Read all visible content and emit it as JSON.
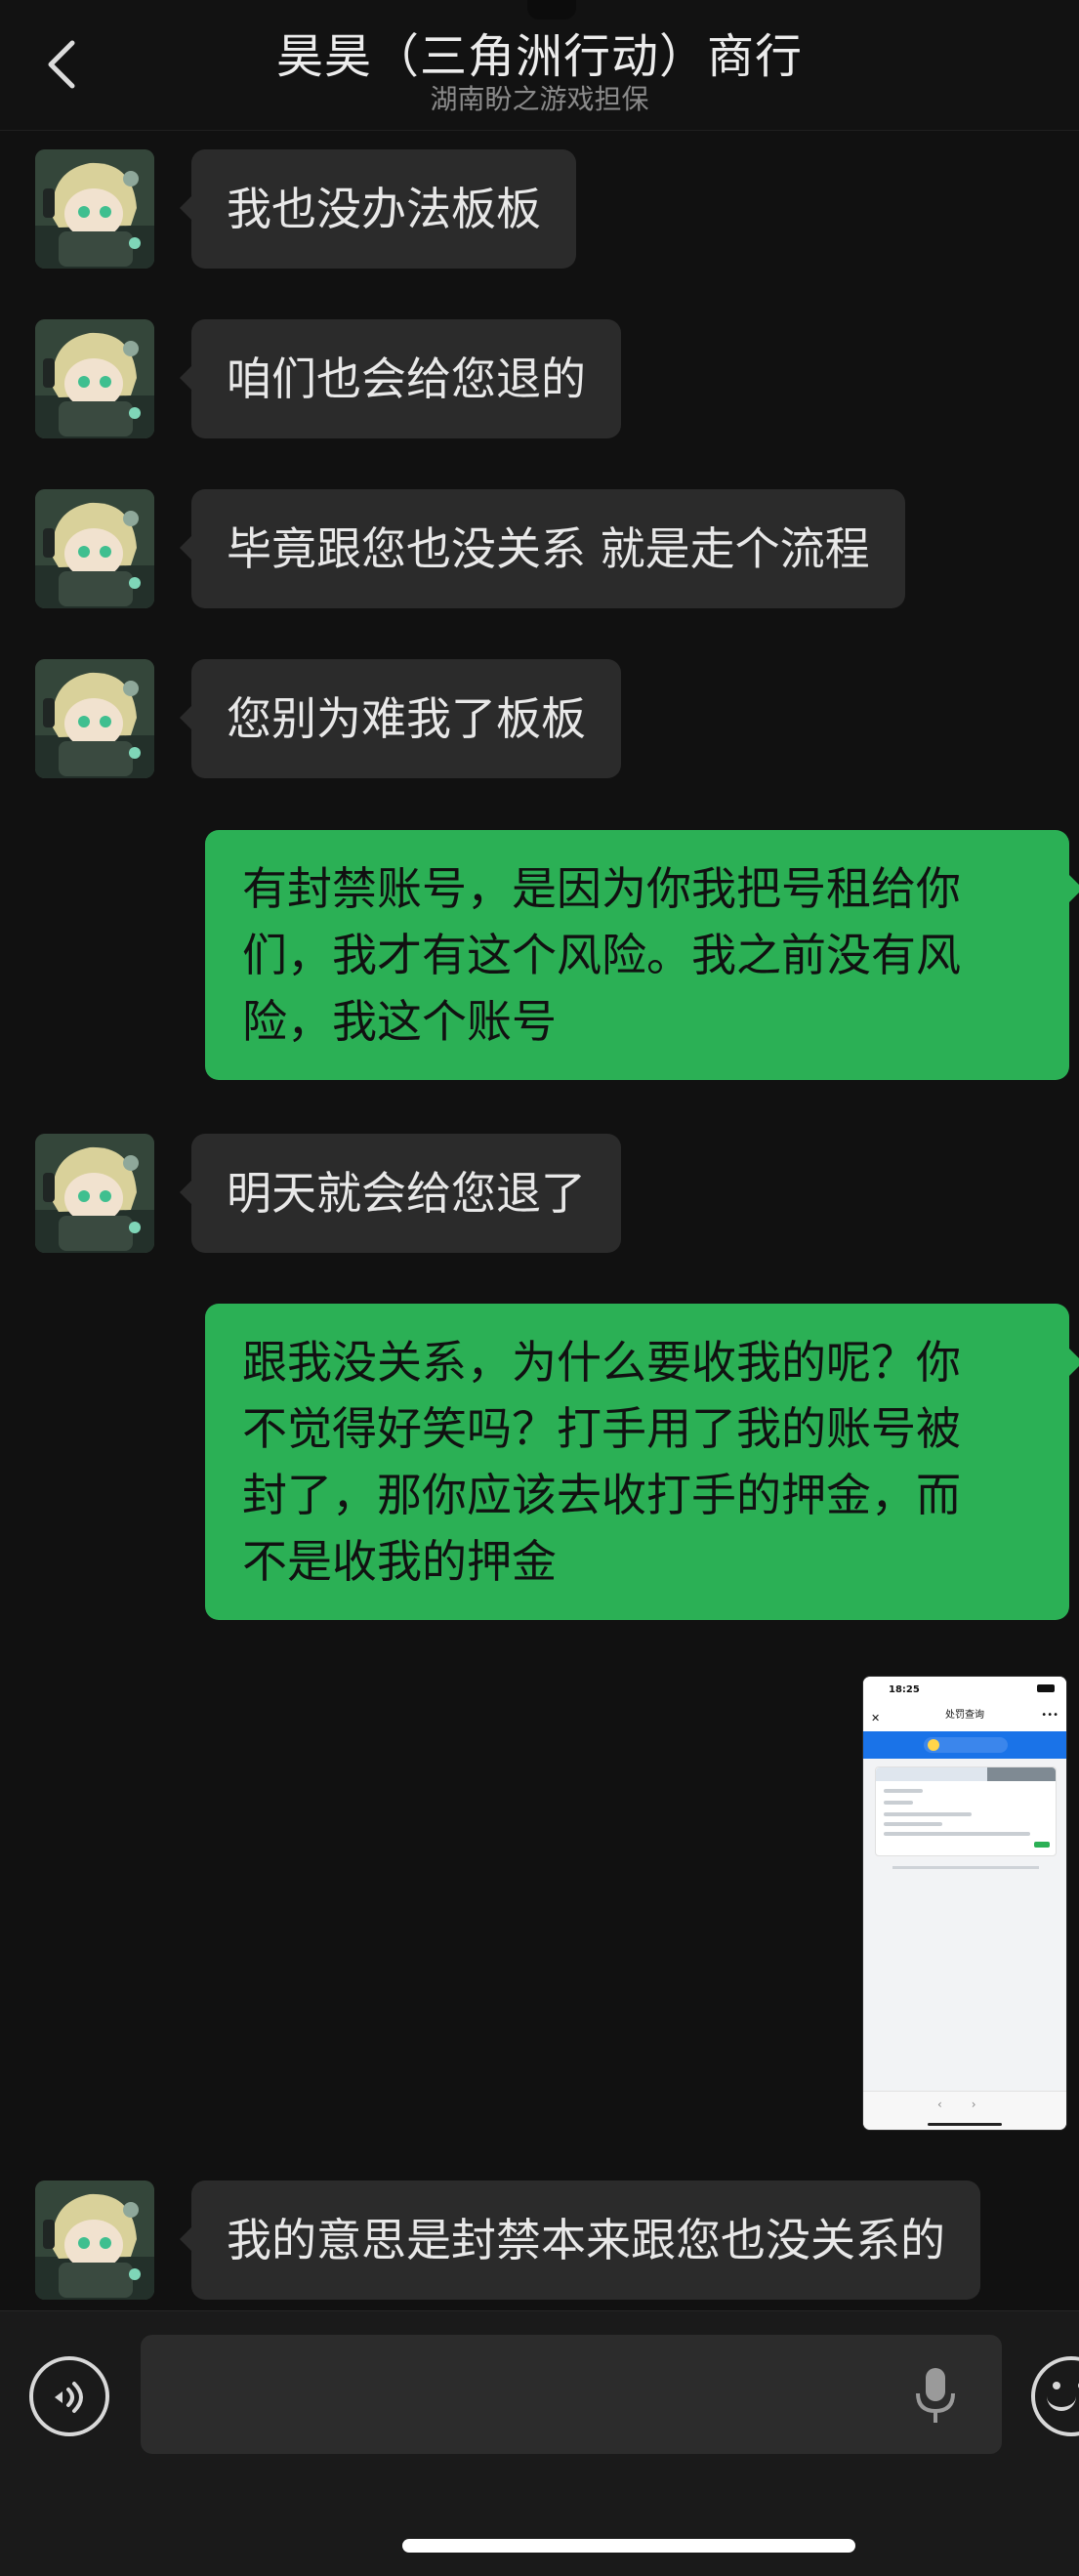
{
  "header": {
    "title": "昊昊（三角洲行动）商行",
    "subtitle": "湖南盼之游戏担保"
  },
  "messages": [
    {
      "side": "left",
      "text": "我也没办法板板"
    },
    {
      "side": "left",
      "text": "咱们也会给您退的"
    },
    {
      "side": "left",
      "text": "毕竟跟您也没关系 就是走个流程"
    },
    {
      "side": "left",
      "text": "您别为难我了板板"
    },
    {
      "side": "right",
      "lines": [
        "有封禁账号，是因为你我把号租给你",
        "们，我才有这个风险。我之前没有风",
        "险，我这个账号"
      ]
    },
    {
      "side": "left",
      "text": "明天就会给您退了"
    },
    {
      "side": "right",
      "lines": [
        "跟我没关系，为什么要收我的呢？你",
        "不觉得好笑吗？打手用了我的账号被",
        "封了，那你应该去收打手的押金，而",
        "不是收我的押金"
      ]
    },
    {
      "side": "right",
      "type": "image",
      "image": {
        "status_time": "18:25",
        "nav_title": "处罚查询"
      }
    },
    {
      "side": "left",
      "text": "我的意思是封禁本来跟您也没关系的"
    }
  ],
  "input": {
    "value": "",
    "placeholder": ""
  },
  "icons": {
    "back": "chevron-left-icon",
    "voice": "voice-icon",
    "mic": "microphone-icon",
    "emoji": "emoji-icon"
  },
  "colors": {
    "background": "#111111",
    "bubble_left": "#2b2b2b",
    "bubble_right": "#2bb055"
  }
}
